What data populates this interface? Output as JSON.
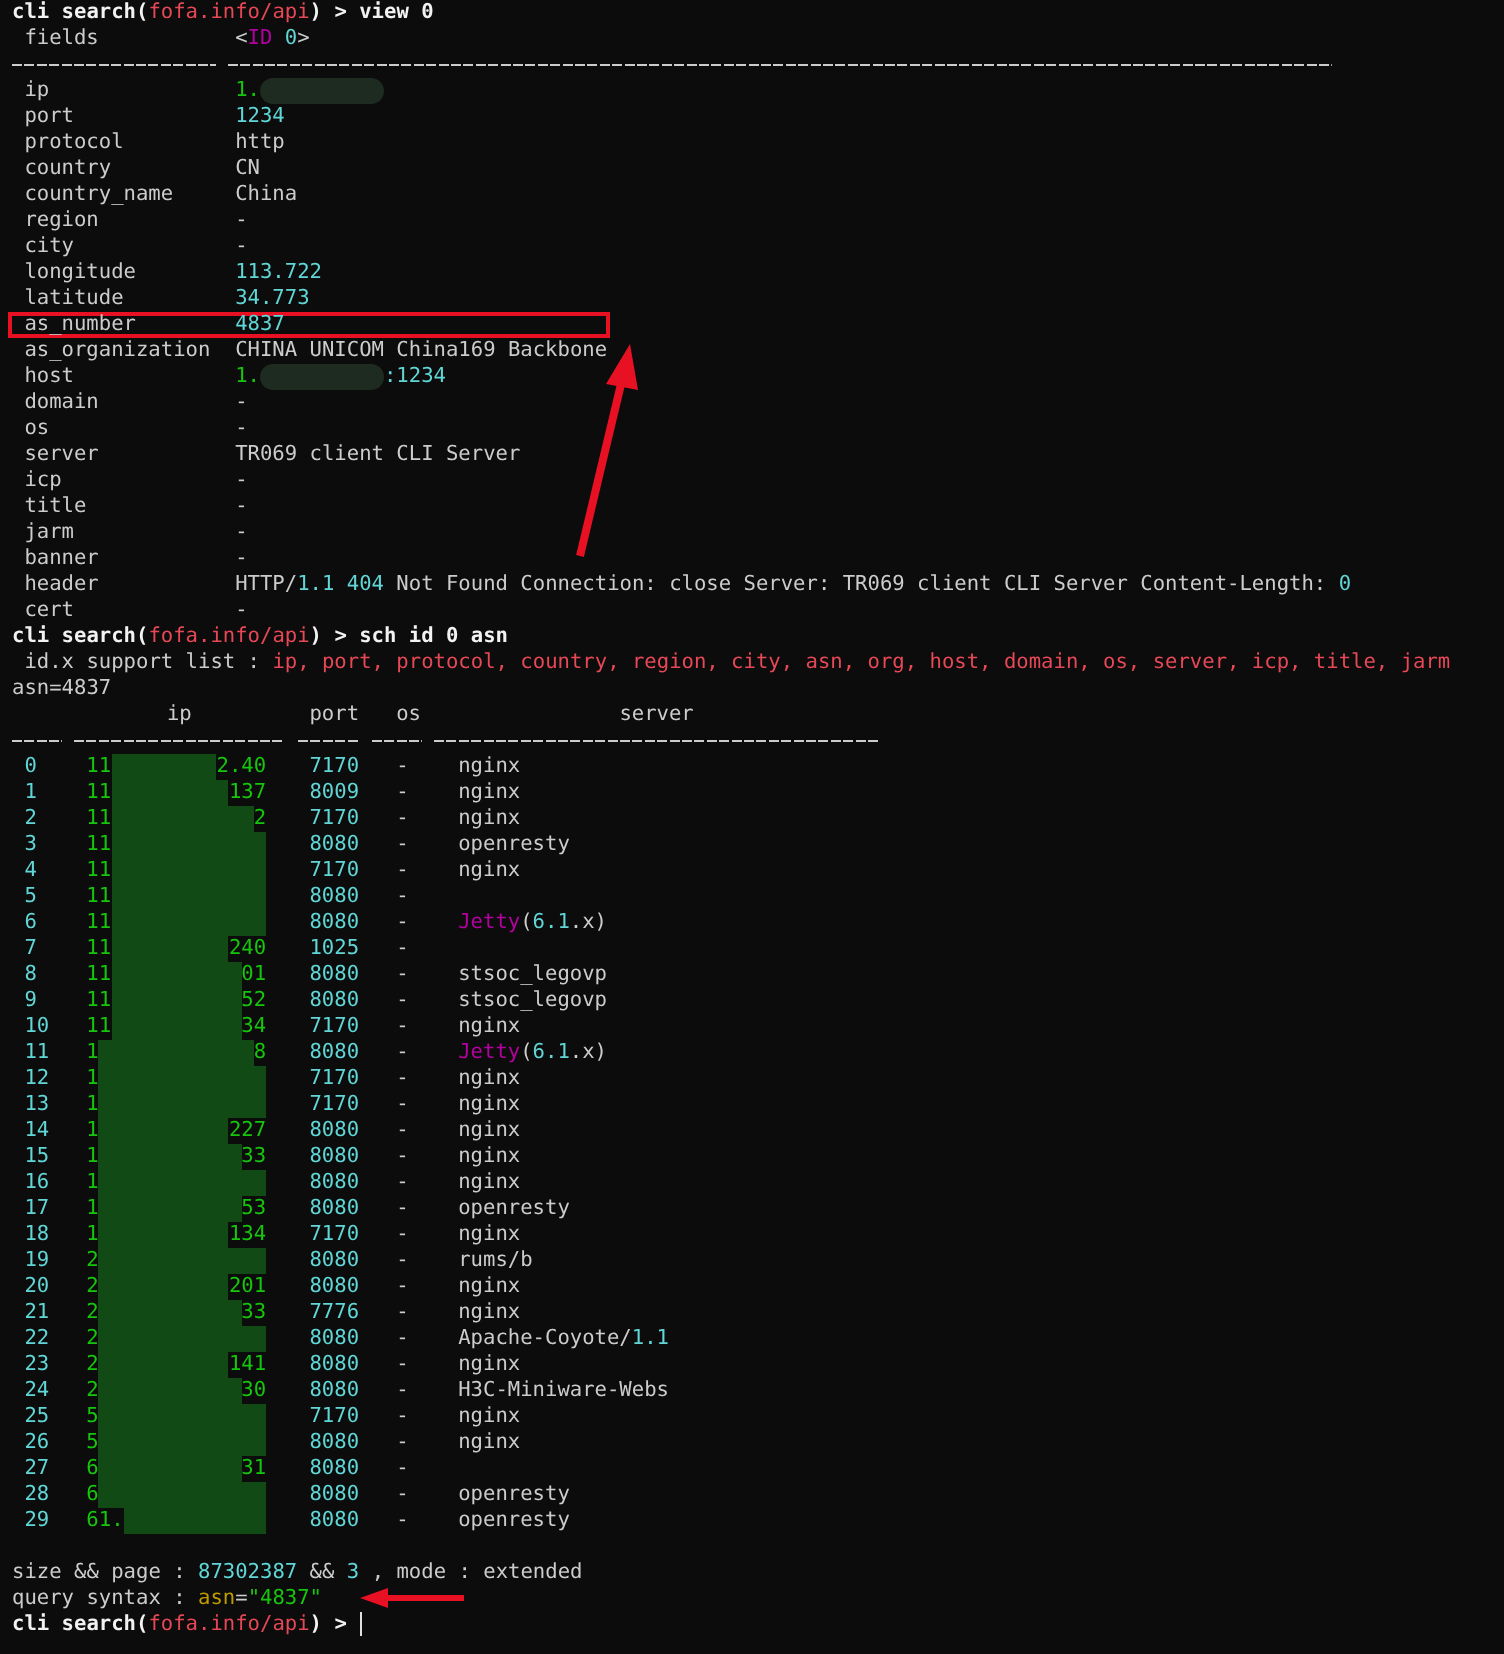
{
  "view_command": [
    {
      "text": "cli search(",
      "kind": "bold"
    },
    {
      "text": "fofa.info/api",
      "kind": "red"
    },
    {
      "text": ") > view 0",
      "kind": "bold"
    }
  ],
  "record": {
    "heading": {
      "key": "fields",
      "value": [
        {
          "text": "<",
          "kind": "plain"
        },
        {
          "text": "ID",
          "kind": "magenta"
        },
        {
          "text": " 0",
          "kind": "cyan"
        },
        {
          "text": ">",
          "kind": "plain"
        }
      ]
    },
    "fields": [
      {
        "key": "ip",
        "highlighted": false,
        "value": [
          {
            "text": "1.",
            "kind": "green"
          },
          {
            "kind": "redaction"
          }
        ]
      },
      {
        "key": "port",
        "highlighted": false,
        "value": [
          {
            "text": "1234",
            "kind": "cyan"
          }
        ]
      },
      {
        "key": "protocol",
        "highlighted": false,
        "value": [
          {
            "text": "http",
            "kind": "plain"
          }
        ]
      },
      {
        "key": "country",
        "highlighted": false,
        "value": [
          {
            "text": "CN",
            "kind": "plain"
          }
        ]
      },
      {
        "key": "country_name",
        "highlighted": false,
        "value": [
          {
            "text": "China",
            "kind": "plain"
          }
        ]
      },
      {
        "key": "region",
        "highlighted": false,
        "value": [
          {
            "text": "-",
            "kind": "plain"
          }
        ]
      },
      {
        "key": "city",
        "highlighted": false,
        "value": [
          {
            "text": "-",
            "kind": "plain"
          }
        ]
      },
      {
        "key": "longitude",
        "highlighted": false,
        "value": [
          {
            "text": "113.722",
            "kind": "cyan"
          }
        ]
      },
      {
        "key": "latitude",
        "highlighted": false,
        "value": [
          {
            "text": "34.773",
            "kind": "cyan"
          }
        ]
      },
      {
        "key": "as_number",
        "highlighted": true,
        "value": [
          {
            "text": "4837",
            "kind": "cyan"
          }
        ]
      },
      {
        "key": "as_organization",
        "highlighted": false,
        "value": [
          {
            "text": "CHINA UNICOM China169 Backbone",
            "kind": "plain"
          }
        ]
      },
      {
        "key": "host",
        "highlighted": false,
        "value": [
          {
            "text": "1.",
            "kind": "green"
          },
          {
            "kind": "redaction"
          },
          {
            "text": ":1234",
            "kind": "cyan"
          }
        ]
      },
      {
        "key": "domain",
        "highlighted": false,
        "value": [
          {
            "text": "-",
            "kind": "plain"
          }
        ]
      },
      {
        "key": "os",
        "highlighted": false,
        "value": [
          {
            "text": "-",
            "kind": "plain"
          }
        ]
      },
      {
        "key": "server",
        "highlighted": false,
        "value": [
          {
            "text": "TR069 client CLI Server",
            "kind": "plain"
          }
        ]
      },
      {
        "key": "icp",
        "highlighted": false,
        "value": [
          {
            "text": "-",
            "kind": "plain"
          }
        ]
      },
      {
        "key": "title",
        "highlighted": false,
        "value": [
          {
            "text": "-",
            "kind": "plain"
          }
        ]
      },
      {
        "key": "jarm",
        "highlighted": false,
        "value": [
          {
            "text": "-",
            "kind": "plain"
          }
        ]
      },
      {
        "key": "banner",
        "highlighted": false,
        "value": [
          {
            "text": "-",
            "kind": "plain"
          }
        ]
      },
      {
        "key": "header",
        "highlighted": false,
        "value": [
          {
            "text": "HTTP/",
            "kind": "plain"
          },
          {
            "text": "1.1 404",
            "kind": "cyan"
          },
          {
            "text": " Not Found Connection: close Server: TR069 client CLI Server Content-Length: ",
            "kind": "plain"
          },
          {
            "text": "0",
            "kind": "cyan"
          }
        ]
      },
      {
        "key": "cert",
        "highlighted": false,
        "value": [
          {
            "text": "-",
            "kind": "plain"
          }
        ]
      }
    ]
  },
  "search_command": [
    {
      "text": "cli search(",
      "kind": "bold"
    },
    {
      "text": "fofa.info/api",
      "kind": "red"
    },
    {
      "text": ") > sch id 0 asn",
      "kind": "bold"
    }
  ],
  "support_list": [
    {
      "text": " id.x support list : ",
      "kind": "plain"
    },
    {
      "text": "ip, port, protocol, country, region, city, asn, org, host, domain, os, server, icp, title, jarm",
      "kind": "red"
    }
  ],
  "query_echo": [
    {
      "text": "asn=4837",
      "kind": "plain"
    }
  ],
  "results": {
    "columns": [
      "ip",
      "port",
      "os",
      "server"
    ],
    "rows": [
      {
        "index": "0",
        "ip": [
          {
            "text": "11",
            "kind": "green"
          },
          {
            "kind": "redaction"
          },
          {
            "text": "2.40",
            "kind": "green"
          }
        ],
        "port": "7170",
        "os": "-",
        "server": [
          {
            "text": "nginx",
            "kind": "plain"
          }
        ]
      },
      {
        "index": "1",
        "ip": [
          {
            "text": "11",
            "kind": "green"
          },
          {
            "kind": "redaction"
          },
          {
            "text": "137",
            "kind": "green"
          }
        ],
        "port": "8009",
        "os": "-",
        "server": [
          {
            "text": "nginx",
            "kind": "plain"
          }
        ]
      },
      {
        "index": "2",
        "ip": [
          {
            "text": "11",
            "kind": "green"
          },
          {
            "kind": "redaction"
          },
          {
            "text": "2",
            "kind": "green"
          }
        ],
        "port": "7170",
        "os": "-",
        "server": [
          {
            "text": "nginx",
            "kind": "plain"
          }
        ]
      },
      {
        "index": "3",
        "ip": [
          {
            "text": "11",
            "kind": "green"
          },
          {
            "kind": "redaction"
          }
        ],
        "port": "8080",
        "os": "-",
        "server": [
          {
            "text": "openresty",
            "kind": "plain"
          }
        ]
      },
      {
        "index": "4",
        "ip": [
          {
            "text": "11",
            "kind": "green"
          },
          {
            "kind": "redaction"
          }
        ],
        "port": "7170",
        "os": "-",
        "server": [
          {
            "text": "nginx",
            "kind": "plain"
          }
        ]
      },
      {
        "index": "5",
        "ip": [
          {
            "text": "11",
            "kind": "green"
          },
          {
            "kind": "redaction"
          }
        ],
        "port": "8080",
        "os": "-"
      },
      {
        "index": "6",
        "ip": [
          {
            "text": "11",
            "kind": "green"
          },
          {
            "kind": "redaction"
          }
        ],
        "port": "8080",
        "os": "-",
        "server": [
          {
            "text": "Jetty",
            "kind": "magenta"
          },
          {
            "text": "(",
            "kind": "plain"
          },
          {
            "text": "6.1",
            "kind": "cyan"
          },
          {
            "text": ".x)",
            "kind": "plain"
          }
        ]
      },
      {
        "index": "7",
        "ip": [
          {
            "text": "11",
            "kind": "green"
          },
          {
            "kind": "redaction"
          },
          {
            "text": "240",
            "kind": "green"
          }
        ],
        "port": "1025",
        "os": "-"
      },
      {
        "index": "8",
        "ip": [
          {
            "text": "11",
            "kind": "green"
          },
          {
            "kind": "redaction"
          },
          {
            "text": "01",
            "kind": "green"
          }
        ],
        "port": "8080",
        "os": "-",
        "server": [
          {
            "text": "stsoc_legovp",
            "kind": "plain"
          }
        ]
      },
      {
        "index": "9",
        "ip": [
          {
            "text": "11",
            "kind": "green"
          },
          {
            "kind": "redaction"
          },
          {
            "text": "52",
            "kind": "green"
          }
        ],
        "port": "8080",
        "os": "-",
        "server": [
          {
            "text": "stsoc_legovp",
            "kind": "plain"
          }
        ]
      },
      {
        "index": "10",
        "ip": [
          {
            "text": "11",
            "kind": "green"
          },
          {
            "kind": "redaction"
          },
          {
            "text": "34",
            "kind": "green"
          }
        ],
        "port": "7170",
        "os": "-",
        "server": [
          {
            "text": "nginx",
            "kind": "plain"
          }
        ]
      },
      {
        "index": "11",
        "ip": [
          {
            "text": "1",
            "kind": "green"
          },
          {
            "kind": "redaction"
          },
          {
            "text": "8",
            "kind": "green"
          }
        ],
        "port": "8080",
        "os": "-",
        "server": [
          {
            "text": "Jetty",
            "kind": "magenta"
          },
          {
            "text": "(",
            "kind": "plain"
          },
          {
            "text": "6.1",
            "kind": "cyan"
          },
          {
            "text": ".x)",
            "kind": "plain"
          }
        ]
      },
      {
        "index": "12",
        "ip": [
          {
            "text": "1",
            "kind": "green"
          },
          {
            "kind": "redaction"
          }
        ],
        "port": "7170",
        "os": "-",
        "server": [
          {
            "text": "nginx",
            "kind": "plain"
          }
        ]
      },
      {
        "index": "13",
        "ip": [
          {
            "text": "1",
            "kind": "green"
          },
          {
            "kind": "redaction"
          }
        ],
        "port": "7170",
        "os": "-",
        "server": [
          {
            "text": "nginx",
            "kind": "plain"
          }
        ]
      },
      {
        "index": "14",
        "ip": [
          {
            "text": "1",
            "kind": "green"
          },
          {
            "kind": "redaction"
          },
          {
            "text": "227",
            "kind": "green"
          }
        ],
        "port": "8080",
        "os": "-",
        "server": [
          {
            "text": "nginx",
            "kind": "plain"
          }
        ]
      },
      {
        "index": "15",
        "ip": [
          {
            "text": "1",
            "kind": "green"
          },
          {
            "kind": "redaction"
          },
          {
            "text": "33",
            "kind": "green"
          }
        ],
        "port": "8080",
        "os": "-",
        "server": [
          {
            "text": "nginx",
            "kind": "plain"
          }
        ]
      },
      {
        "index": "16",
        "ip": [
          {
            "text": "1",
            "kind": "green"
          },
          {
            "kind": "redaction"
          }
        ],
        "port": "8080",
        "os": "-",
        "server": [
          {
            "text": "nginx",
            "kind": "plain"
          }
        ]
      },
      {
        "index": "17",
        "ip": [
          {
            "text": "1",
            "kind": "green"
          },
          {
            "kind": "redaction"
          },
          {
            "text": "53",
            "kind": "green"
          }
        ],
        "port": "8080",
        "os": "-",
        "server": [
          {
            "text": "openresty",
            "kind": "plain"
          }
        ]
      },
      {
        "index": "18",
        "ip": [
          {
            "text": "1",
            "kind": "green"
          },
          {
            "kind": "redaction"
          },
          {
            "text": "134",
            "kind": "green"
          }
        ],
        "port": "7170",
        "os": "-",
        "server": [
          {
            "text": "nginx",
            "kind": "plain"
          }
        ]
      },
      {
        "index": "19",
        "ip": [
          {
            "text": "2",
            "kind": "green"
          },
          {
            "kind": "redaction"
          }
        ],
        "port": "8080",
        "os": "-",
        "server": [
          {
            "text": "rums/b",
            "kind": "plain"
          }
        ]
      },
      {
        "index": "20",
        "ip": [
          {
            "text": "2",
            "kind": "green"
          },
          {
            "kind": "redaction"
          },
          {
            "text": "201",
            "kind": "green"
          }
        ],
        "port": "8080",
        "os": "-",
        "server": [
          {
            "text": "nginx",
            "kind": "plain"
          }
        ]
      },
      {
        "index": "21",
        "ip": [
          {
            "text": "2",
            "kind": "green"
          },
          {
            "kind": "redaction"
          },
          {
            "text": "33",
            "kind": "green"
          }
        ],
        "port": "7776",
        "os": "-",
        "server": [
          {
            "text": "nginx",
            "kind": "plain"
          }
        ]
      },
      {
        "index": "22",
        "ip": [
          {
            "text": "2",
            "kind": "green"
          },
          {
            "kind": "redaction"
          }
        ],
        "port": "8080",
        "os": "-",
        "server": [
          {
            "text": "Apache-Coyote/",
            "kind": "plain"
          },
          {
            "text": "1.1",
            "kind": "cyan"
          }
        ]
      },
      {
        "index": "23",
        "ip": [
          {
            "text": "2",
            "kind": "green"
          },
          {
            "kind": "redaction"
          },
          {
            "text": "141",
            "kind": "green"
          }
        ],
        "port": "8080",
        "os": "-",
        "server": [
          {
            "text": "nginx",
            "kind": "plain"
          }
        ]
      },
      {
        "index": "24",
        "ip": [
          {
            "text": "2",
            "kind": "green"
          },
          {
            "kind": "redaction"
          },
          {
            "text": "30",
            "kind": "green"
          }
        ],
        "port": "8080",
        "os": "-",
        "server": [
          {
            "text": "H3C-Miniware-Webs",
            "kind": "plain"
          }
        ]
      },
      {
        "index": "25",
        "ip": [
          {
            "text": "5",
            "kind": "green"
          },
          {
            "kind": "redaction"
          }
        ],
        "port": "7170",
        "os": "-",
        "server": [
          {
            "text": "nginx",
            "kind": "plain"
          }
        ]
      },
      {
        "index": "26",
        "ip": [
          {
            "text": "5",
            "kind": "green"
          },
          {
            "kind": "redaction"
          }
        ],
        "port": "8080",
        "os": "-",
        "server": [
          {
            "text": "nginx",
            "kind": "plain"
          }
        ]
      },
      {
        "index": "27",
        "ip": [
          {
            "text": "6",
            "kind": "green"
          },
          {
            "kind": "redaction"
          },
          {
            "text": "31",
            "kind": "green"
          }
        ],
        "port": "8080",
        "os": "-"
      },
      {
        "index": "28",
        "ip": [
          {
            "text": "6",
            "kind": "green"
          },
          {
            "kind": "redaction"
          }
        ],
        "port": "8080",
        "os": "-",
        "server": [
          {
            "text": "openresty",
            "kind": "plain"
          }
        ]
      },
      {
        "index": "29",
        "ip": [
          {
            "text": "61.",
            "kind": "green"
          },
          {
            "kind": "redaction"
          }
        ],
        "port": "8080",
        "os": "-",
        "server": [
          {
            "text": "openresty",
            "kind": "plain"
          }
        ]
      }
    ]
  },
  "summary": [
    [
      {
        "text": "size && page : ",
        "kind": "plain"
      },
      {
        "text": "87302387",
        "kind": "cyan"
      },
      {
        "text": " && ",
        "kind": "plain"
      },
      {
        "text": "3",
        "kind": "cyan"
      },
      {
        "text": " , mode : extended",
        "kind": "plain"
      }
    ],
    [
      {
        "text": "query syntax : ",
        "kind": "plain"
      },
      {
        "text": "asn",
        "kind": "yellow"
      },
      {
        "text": "=",
        "kind": "plain"
      },
      {
        "text": "\"4837\"",
        "kind": "green"
      }
    ]
  ],
  "input_prompt": [
    {
      "text": "cli search(",
      "kind": "bold"
    },
    {
      "text": "fofa.info/api",
      "kind": "red"
    },
    {
      "text": ") > ",
      "kind": "bold"
    }
  ]
}
